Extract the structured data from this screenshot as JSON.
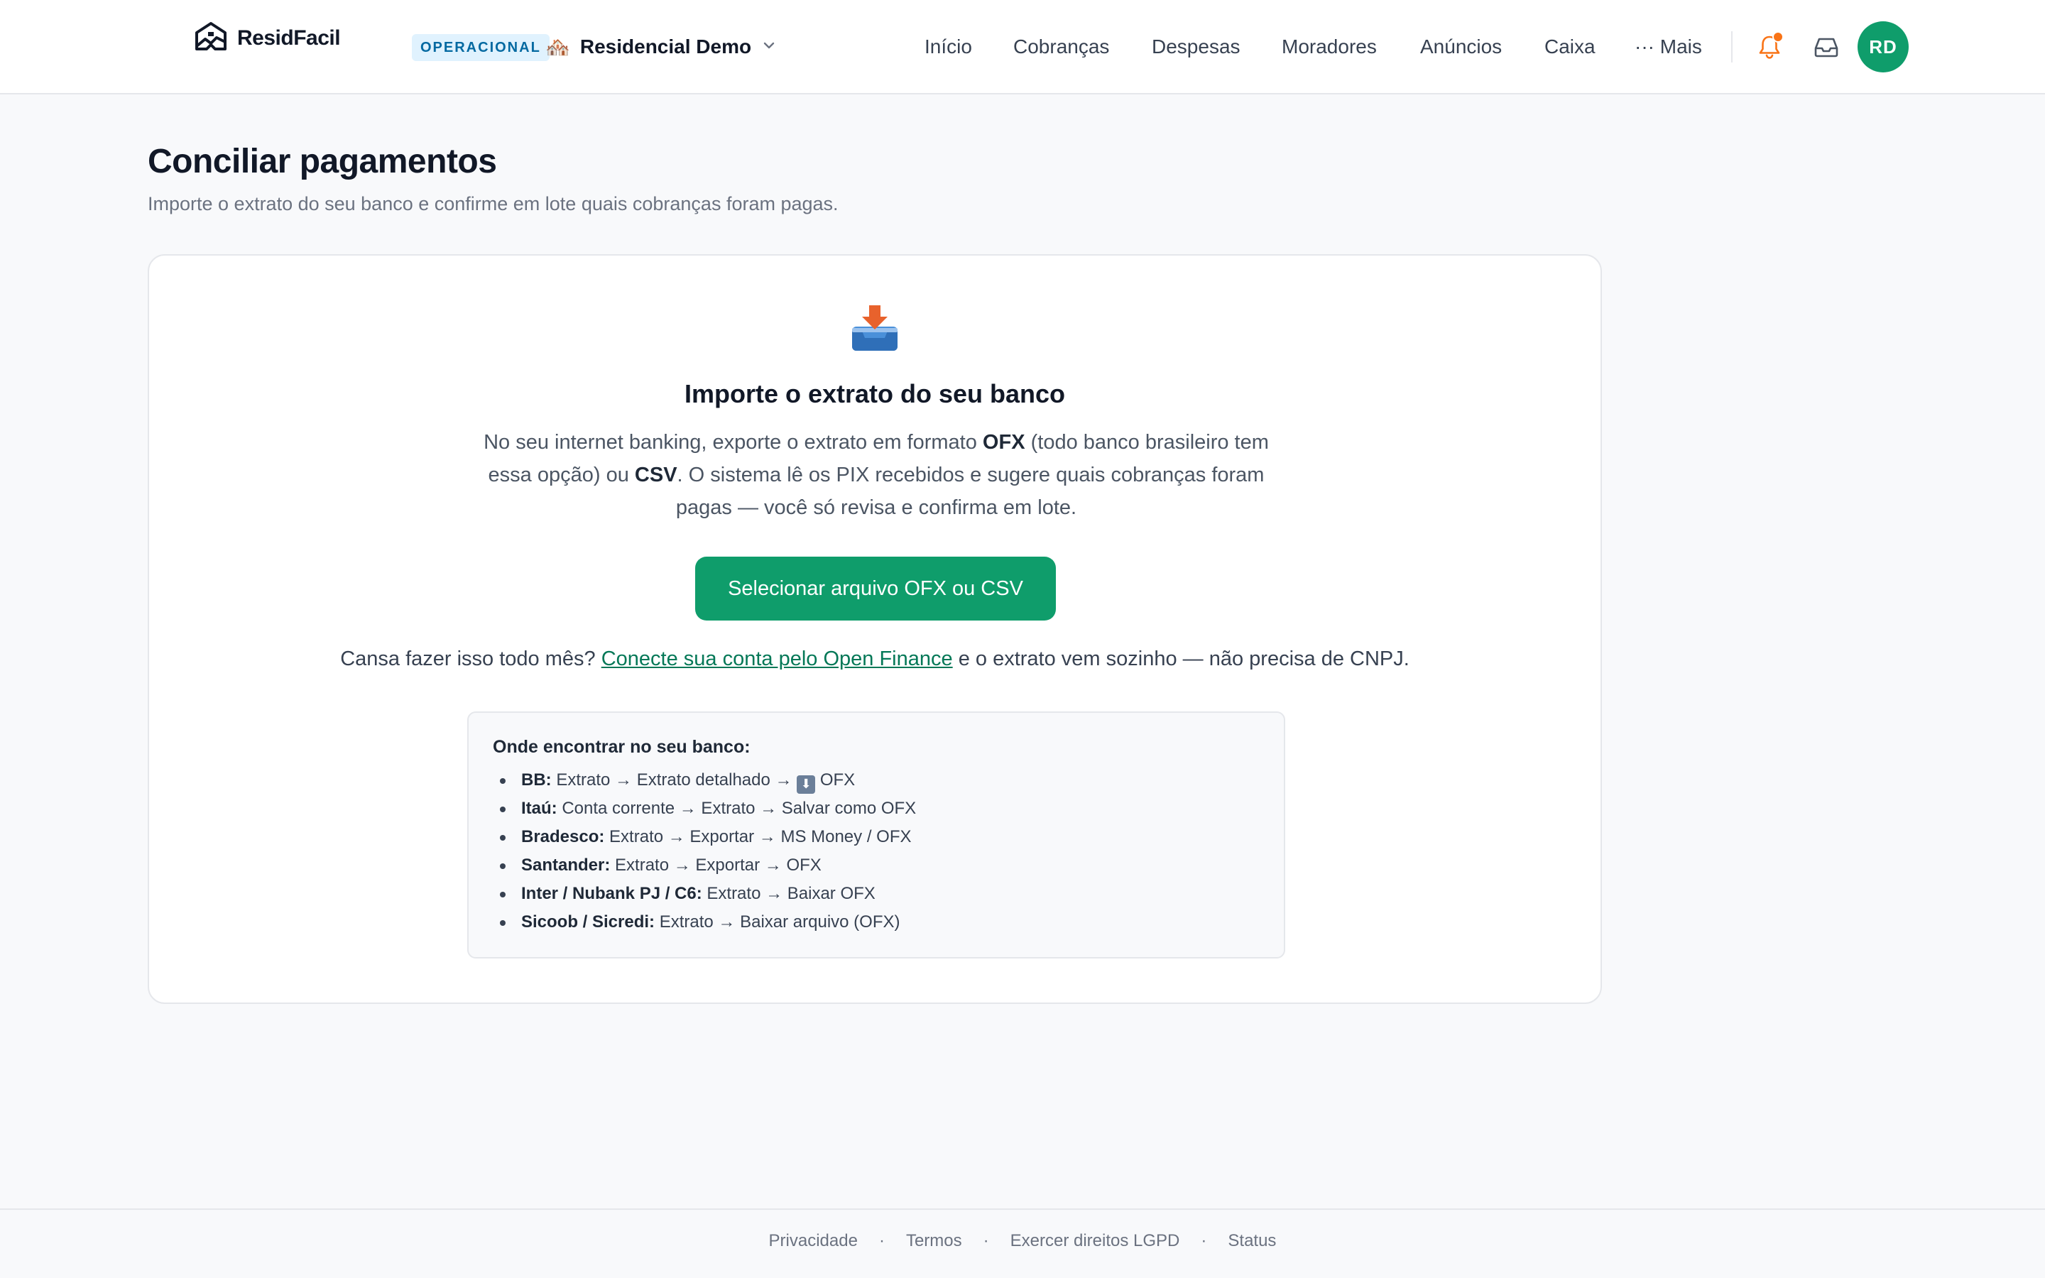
{
  "header": {
    "logo_text": "ResidFacil",
    "env_badge": "OPERACIONAL",
    "condo_emoji": "🏘️",
    "condo_name": "Residencial Demo",
    "nav": [
      {
        "label": "Início"
      },
      {
        "label": "Cobranças"
      },
      {
        "label": "Despesas"
      },
      {
        "label": "Moradores"
      },
      {
        "label": "Anúncios"
      },
      {
        "label": "Caixa"
      },
      {
        "label": "··· Mais"
      }
    ],
    "avatar_initials": "RD",
    "notification_icon": "bell-icon",
    "inbox_icon": "inbox-icon"
  },
  "page": {
    "title": "Conciliar pagamentos",
    "subtitle": "Importe o extrato do seu banco e confirme em lote quais cobranças foram pagas."
  },
  "import_card": {
    "icon": "inbox-tray-icon",
    "title": "Importe o extrato do seu banco",
    "desc_part1": "No seu internet banking, exporte o extrato em formato ",
    "desc_bold1": "OFX",
    "desc_part2": " (todo banco brasileiro tem essa opção) ou ",
    "desc_bold2": "CSV",
    "desc_part3": ". O sistema lê os PIX recebidos e sugere quais cobranças foram pagas — você só revisa e confirma em lote.",
    "button_label": "Selecionar arquivo OFX ou CSV",
    "of_prefix": "Cansa fazer isso todo mês? ",
    "of_link": "Conecte sua conta pelo Open Finance",
    "of_suffix": " e o extrato vem sozinho — não precisa de CNPJ.",
    "banks_title": "Onde encontrar no seu banco:",
    "banks": [
      {
        "name": "BB:",
        "path": "Extrato → Extrato detalhado → ",
        "emoji": "⬇",
        "tail": " OFX"
      },
      {
        "name": "Itaú:",
        "path": "Conta corrente → Extrato → Salvar como OFX",
        "emoji": "",
        "tail": ""
      },
      {
        "name": "Bradesco:",
        "path": "Extrato → Exportar → MS Money / OFX",
        "emoji": "",
        "tail": ""
      },
      {
        "name": "Santander:",
        "path": "Extrato → Exportar → OFX",
        "emoji": "",
        "tail": ""
      },
      {
        "name": "Inter / Nubank PJ / C6:",
        "path": "Extrato → Baixar OFX",
        "emoji": "",
        "tail": ""
      },
      {
        "name": "Sicoob / Sicredi:",
        "path": "Extrato → Baixar arquivo (OFX)",
        "emoji": "",
        "tail": ""
      }
    ]
  },
  "footer": {
    "links": [
      "Privacidade",
      "Termos",
      "Exercer direitos LGPD",
      "Status"
    ],
    "separator": "·"
  },
  "colors": {
    "brand_green": "#0f9d6b",
    "link_green": "#047857",
    "badge_bg": "#e0f2fe",
    "badge_text": "#0369a1",
    "notification_orange": "#f97316"
  }
}
